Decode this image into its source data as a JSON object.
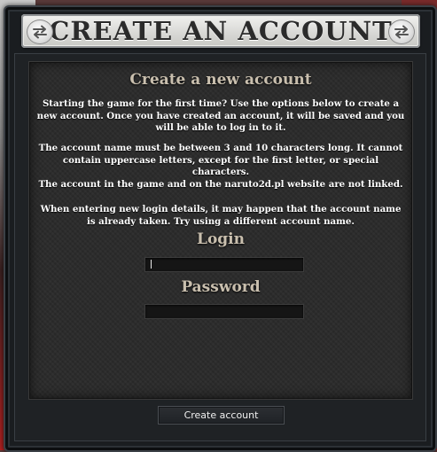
{
  "window": {
    "title": "CREATE AN ACCOUNT",
    "icons": [
      "swap-arrows-icon",
      "swap-arrows-icon"
    ]
  },
  "form": {
    "heading": "Create a new account",
    "paragraphs": [
      "Starting the game for the first time? Use the options below to create a new account. Once you have created an account, it will be saved and you will be able to log in to it.",
      "The account name must be between 3 and 10 characters long. It cannot contain uppercase letters, except for the first letter, or special characters.",
      "The account in the game and on the naruto2d.pl website are not linked.",
      "When entering new login details, it may happen that the account name is already taken. Try using a different account name."
    ],
    "login_label": "Login",
    "login_value": "",
    "password_label": "Password",
    "password_value": ""
  },
  "actions": {
    "create_label": "Create account"
  },
  "colors": {
    "heading": "#c9bfae",
    "body_text": "#ffffff",
    "panel": "#2a2a2a",
    "frame": "#1a1d20",
    "title_plate": "#dedede"
  }
}
